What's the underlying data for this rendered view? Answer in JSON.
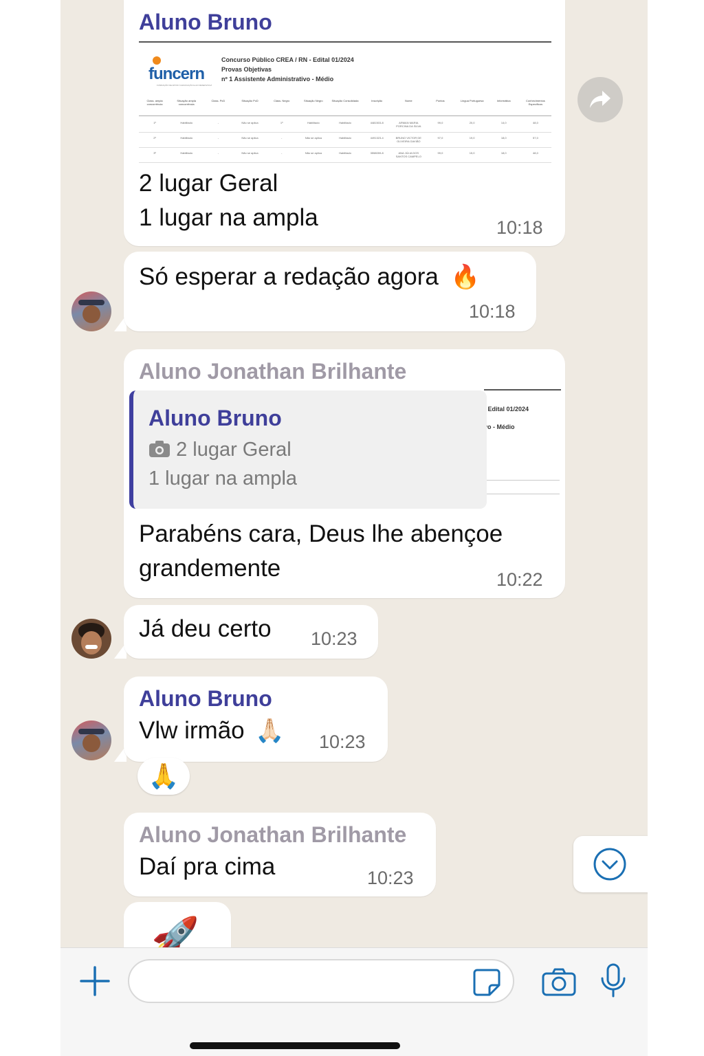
{
  "messages": [
    {
      "sender": "Aluno Bruno",
      "doc_header": {
        "logo": "funcern",
        "logo_sub": "FUNDAÇÃO DE APOIO À EDUCAÇÃO E AO DESENVOLVIMENTO TECNOLÓGICO DO RN",
        "line1": "Concurso Público CREA / RN - Edital 01/2024",
        "line2": "Provas Objetivas",
        "line3": "nº 1 Assistente Administrativo - Médio"
      },
      "doc_columns": [
        "Class. ampla concorrência",
        "Situação ampla concorrência",
        "Class. PcD",
        "Situação PcD",
        "Class. Negro",
        "Situação Negro",
        "Situação Consolidada",
        "Inscrição",
        "Nome",
        "Pontos",
        "Língua Portuguesa",
        "Informática",
        "Conhecimentos Específicos"
      ],
      "doc_rows": [
        [
          "1º",
          "Habilitado",
          "-",
          "Não se aplica",
          "1º",
          "Habilitado",
          "Habilitado",
          "4481503-8",
          "ARMAN MARIA PORCINA DA SILVA",
          "99,0",
          "20,0",
          "14,0",
          "48,0"
        ],
        [
          "2º",
          "Habilitado",
          "-",
          "Não se aplica",
          "-",
          "Não se aplica",
          "Habilitado",
          "4491323-4",
          "BRUNO VICTOR DE OLIVEIRA GAVIÃO",
          "97,0",
          "19,0",
          "18,0",
          "57,0"
        ],
        [
          "3º",
          "Habilitado",
          "-",
          "Não se aplica",
          "-",
          "Não se aplica",
          "Habilitado",
          "3558059-8",
          "ANA JÚLIA DOS SANTOS CAMPELO",
          "99,0",
          "15,0",
          "18,0",
          "48,0"
        ]
      ],
      "text1": "2 lugar Geral",
      "text2": "1 lugar na ampla",
      "time": "10:18"
    },
    {
      "text": "Só esperar a redação agora",
      "emoji": "🔥",
      "time": "10:18"
    },
    {
      "sender": "Aluno Jonathan Brilhante",
      "quote_sender": "Aluno Bruno",
      "quote_line1": "2 lugar Geral",
      "quote_line2": "1 lugar na ampla",
      "quote_doc_l1": "- Edital 01/2024",
      "quote_doc_l2": "vo - Médio",
      "text1": "Parabéns cara, Deus lhe abençoe",
      "text2": "grandemente",
      "time": "10:22"
    },
    {
      "text": "Já deu certo",
      "time": "10:23"
    },
    {
      "sender": "Aluno Bruno",
      "text": "Vlw irmão",
      "emoji": "🙏🏻",
      "time": "10:23",
      "reaction": "🙏"
    },
    {
      "sender": "Aluno Jonathan Brilhante",
      "text": "Daí pra cima",
      "time": "10:23"
    },
    {
      "sticker": "🚀"
    }
  ],
  "composer": {
    "placeholder": ""
  },
  "colors": {
    "chat_bg": "#efeae2",
    "sender_blue": "#3f3f9a",
    "sender_gray": "#a09aa6",
    "icon_blue": "#1a6fb3"
  },
  "icons": [
    "forward-icon",
    "scroll-down-icon",
    "plus-icon",
    "sticker-icon",
    "camera-icon",
    "microphone-icon"
  ]
}
